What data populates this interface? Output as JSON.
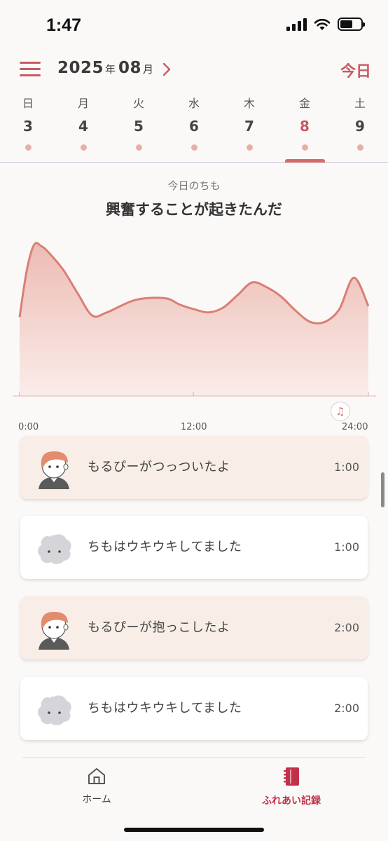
{
  "status_bar": {
    "time": "1:47"
  },
  "header": {
    "year": "2025",
    "year_suffix": "年",
    "month": "08",
    "month_suffix": "月",
    "next_icon": "chevron-right-icon",
    "today_label": "今日",
    "menu_icon": "hamburger-menu-icon"
  },
  "week": {
    "days": [
      {
        "name": "日",
        "num": "3"
      },
      {
        "name": "月",
        "num": "4"
      },
      {
        "name": "火",
        "num": "5"
      },
      {
        "name": "水",
        "num": "6"
      },
      {
        "name": "木",
        "num": "7"
      },
      {
        "name": "金",
        "num": "8"
      },
      {
        "name": "土",
        "num": "9"
      }
    ],
    "selected_index": 5
  },
  "mood": {
    "subtitle": "今日のちも",
    "title": "興奮することが起きたんだ"
  },
  "chart_data": {
    "type": "area",
    "x_ticks": [
      "0:00",
      "12:00",
      "24:00"
    ],
    "xlim": [
      0,
      24
    ],
    "x": [
      0,
      0.5,
      1,
      1.5,
      2,
      3,
      4,
      5,
      6,
      8,
      10,
      11,
      12,
      13,
      14,
      15,
      16,
      17,
      18,
      19,
      20,
      21,
      22,
      23,
      24
    ],
    "y": [
      50,
      80,
      96,
      95,
      91,
      80,
      65,
      51,
      53,
      61,
      62,
      58,
      55,
      53,
      56,
      64,
      72,
      69,
      63,
      54,
      47,
      47,
      55,
      75,
      57
    ],
    "ylim": [
      0,
      100
    ],
    "colors": {
      "line": "#d97f74",
      "fill_top": "#ecbcb3",
      "fill_bottom": "#fbecea"
    }
  },
  "events": [
    {
      "type": "person",
      "text": "もるぴーがつっついたよ",
      "time": "1:00"
    },
    {
      "type": "chimo",
      "text": "ちもはウキウキしてました",
      "time": "1:00"
    },
    {
      "type": "person",
      "text": "もるぴーが抱っこしたよ",
      "time": "2:00"
    },
    {
      "type": "chimo",
      "text": "ちもはウキウキしてました",
      "time": "2:00"
    }
  ],
  "tabs": [
    {
      "label": "ホーム",
      "icon": "home-icon"
    },
    {
      "label": "ふれあい記録",
      "icon": "notebook-icon"
    }
  ],
  "colors": {
    "accent": "#c85a64",
    "person_card": "#f8eee7"
  }
}
